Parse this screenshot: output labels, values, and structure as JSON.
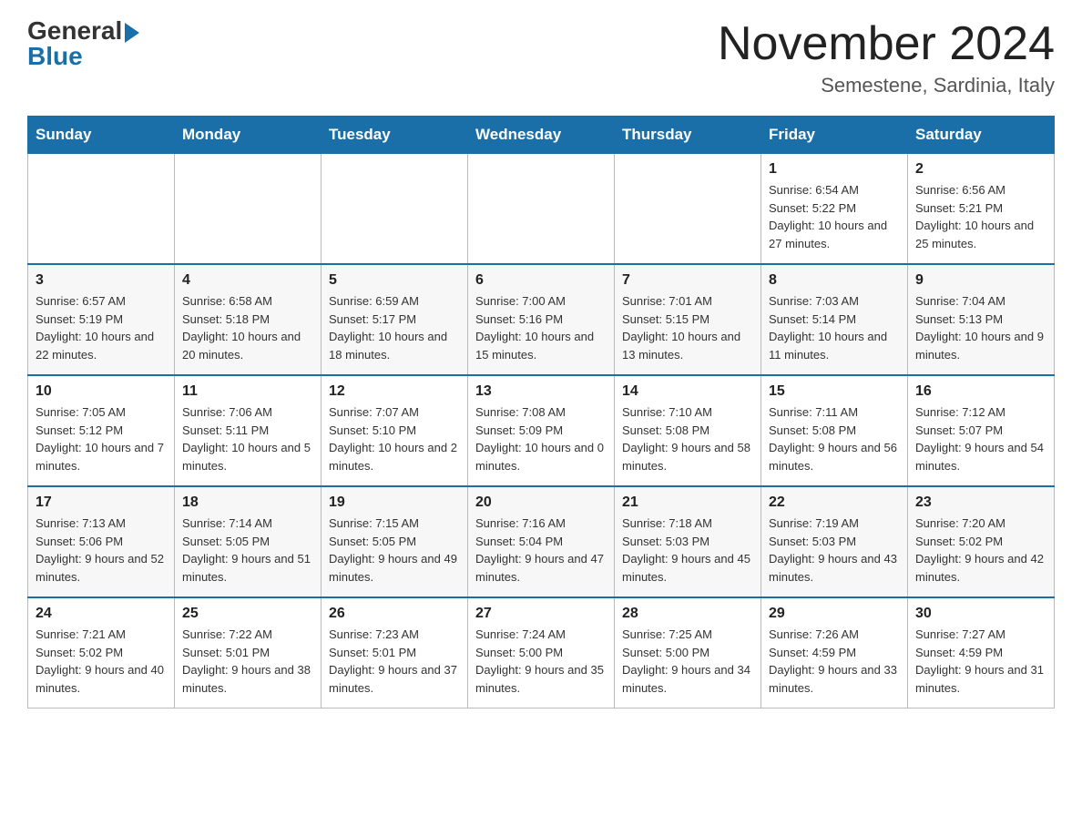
{
  "logo": {
    "general": "General",
    "blue": "Blue"
  },
  "header": {
    "month_title": "November 2024",
    "subtitle": "Semestene, Sardinia, Italy"
  },
  "weekdays": [
    "Sunday",
    "Monday",
    "Tuesday",
    "Wednesday",
    "Thursday",
    "Friday",
    "Saturday"
  ],
  "weeks": [
    [
      {
        "day": "",
        "sunrise": "",
        "sunset": "",
        "daylight": ""
      },
      {
        "day": "",
        "sunrise": "",
        "sunset": "",
        "daylight": ""
      },
      {
        "day": "",
        "sunrise": "",
        "sunset": "",
        "daylight": ""
      },
      {
        "day": "",
        "sunrise": "",
        "sunset": "",
        "daylight": ""
      },
      {
        "day": "",
        "sunrise": "",
        "sunset": "",
        "daylight": ""
      },
      {
        "day": "1",
        "sunrise": "Sunrise: 6:54 AM",
        "sunset": "Sunset: 5:22 PM",
        "daylight": "Daylight: 10 hours and 27 minutes."
      },
      {
        "day": "2",
        "sunrise": "Sunrise: 6:56 AM",
        "sunset": "Sunset: 5:21 PM",
        "daylight": "Daylight: 10 hours and 25 minutes."
      }
    ],
    [
      {
        "day": "3",
        "sunrise": "Sunrise: 6:57 AM",
        "sunset": "Sunset: 5:19 PM",
        "daylight": "Daylight: 10 hours and 22 minutes."
      },
      {
        "day": "4",
        "sunrise": "Sunrise: 6:58 AM",
        "sunset": "Sunset: 5:18 PM",
        "daylight": "Daylight: 10 hours and 20 minutes."
      },
      {
        "day": "5",
        "sunrise": "Sunrise: 6:59 AM",
        "sunset": "Sunset: 5:17 PM",
        "daylight": "Daylight: 10 hours and 18 minutes."
      },
      {
        "day": "6",
        "sunrise": "Sunrise: 7:00 AM",
        "sunset": "Sunset: 5:16 PM",
        "daylight": "Daylight: 10 hours and 15 minutes."
      },
      {
        "day": "7",
        "sunrise": "Sunrise: 7:01 AM",
        "sunset": "Sunset: 5:15 PM",
        "daylight": "Daylight: 10 hours and 13 minutes."
      },
      {
        "day": "8",
        "sunrise": "Sunrise: 7:03 AM",
        "sunset": "Sunset: 5:14 PM",
        "daylight": "Daylight: 10 hours and 11 minutes."
      },
      {
        "day": "9",
        "sunrise": "Sunrise: 7:04 AM",
        "sunset": "Sunset: 5:13 PM",
        "daylight": "Daylight: 10 hours and 9 minutes."
      }
    ],
    [
      {
        "day": "10",
        "sunrise": "Sunrise: 7:05 AM",
        "sunset": "Sunset: 5:12 PM",
        "daylight": "Daylight: 10 hours and 7 minutes."
      },
      {
        "day": "11",
        "sunrise": "Sunrise: 7:06 AM",
        "sunset": "Sunset: 5:11 PM",
        "daylight": "Daylight: 10 hours and 5 minutes."
      },
      {
        "day": "12",
        "sunrise": "Sunrise: 7:07 AM",
        "sunset": "Sunset: 5:10 PM",
        "daylight": "Daylight: 10 hours and 2 minutes."
      },
      {
        "day": "13",
        "sunrise": "Sunrise: 7:08 AM",
        "sunset": "Sunset: 5:09 PM",
        "daylight": "Daylight: 10 hours and 0 minutes."
      },
      {
        "day": "14",
        "sunrise": "Sunrise: 7:10 AM",
        "sunset": "Sunset: 5:08 PM",
        "daylight": "Daylight: 9 hours and 58 minutes."
      },
      {
        "day": "15",
        "sunrise": "Sunrise: 7:11 AM",
        "sunset": "Sunset: 5:08 PM",
        "daylight": "Daylight: 9 hours and 56 minutes."
      },
      {
        "day": "16",
        "sunrise": "Sunrise: 7:12 AM",
        "sunset": "Sunset: 5:07 PM",
        "daylight": "Daylight: 9 hours and 54 minutes."
      }
    ],
    [
      {
        "day": "17",
        "sunrise": "Sunrise: 7:13 AM",
        "sunset": "Sunset: 5:06 PM",
        "daylight": "Daylight: 9 hours and 52 minutes."
      },
      {
        "day": "18",
        "sunrise": "Sunrise: 7:14 AM",
        "sunset": "Sunset: 5:05 PM",
        "daylight": "Daylight: 9 hours and 51 minutes."
      },
      {
        "day": "19",
        "sunrise": "Sunrise: 7:15 AM",
        "sunset": "Sunset: 5:05 PM",
        "daylight": "Daylight: 9 hours and 49 minutes."
      },
      {
        "day": "20",
        "sunrise": "Sunrise: 7:16 AM",
        "sunset": "Sunset: 5:04 PM",
        "daylight": "Daylight: 9 hours and 47 minutes."
      },
      {
        "day": "21",
        "sunrise": "Sunrise: 7:18 AM",
        "sunset": "Sunset: 5:03 PM",
        "daylight": "Daylight: 9 hours and 45 minutes."
      },
      {
        "day": "22",
        "sunrise": "Sunrise: 7:19 AM",
        "sunset": "Sunset: 5:03 PM",
        "daylight": "Daylight: 9 hours and 43 minutes."
      },
      {
        "day": "23",
        "sunrise": "Sunrise: 7:20 AM",
        "sunset": "Sunset: 5:02 PM",
        "daylight": "Daylight: 9 hours and 42 minutes."
      }
    ],
    [
      {
        "day": "24",
        "sunrise": "Sunrise: 7:21 AM",
        "sunset": "Sunset: 5:02 PM",
        "daylight": "Daylight: 9 hours and 40 minutes."
      },
      {
        "day": "25",
        "sunrise": "Sunrise: 7:22 AM",
        "sunset": "Sunset: 5:01 PM",
        "daylight": "Daylight: 9 hours and 38 minutes."
      },
      {
        "day": "26",
        "sunrise": "Sunrise: 7:23 AM",
        "sunset": "Sunset: 5:01 PM",
        "daylight": "Daylight: 9 hours and 37 minutes."
      },
      {
        "day": "27",
        "sunrise": "Sunrise: 7:24 AM",
        "sunset": "Sunset: 5:00 PM",
        "daylight": "Daylight: 9 hours and 35 minutes."
      },
      {
        "day": "28",
        "sunrise": "Sunrise: 7:25 AM",
        "sunset": "Sunset: 5:00 PM",
        "daylight": "Daylight: 9 hours and 34 minutes."
      },
      {
        "day": "29",
        "sunrise": "Sunrise: 7:26 AM",
        "sunset": "Sunset: 4:59 PM",
        "daylight": "Daylight: 9 hours and 33 minutes."
      },
      {
        "day": "30",
        "sunrise": "Sunrise: 7:27 AM",
        "sunset": "Sunset: 4:59 PM",
        "daylight": "Daylight: 9 hours and 31 minutes."
      }
    ]
  ]
}
